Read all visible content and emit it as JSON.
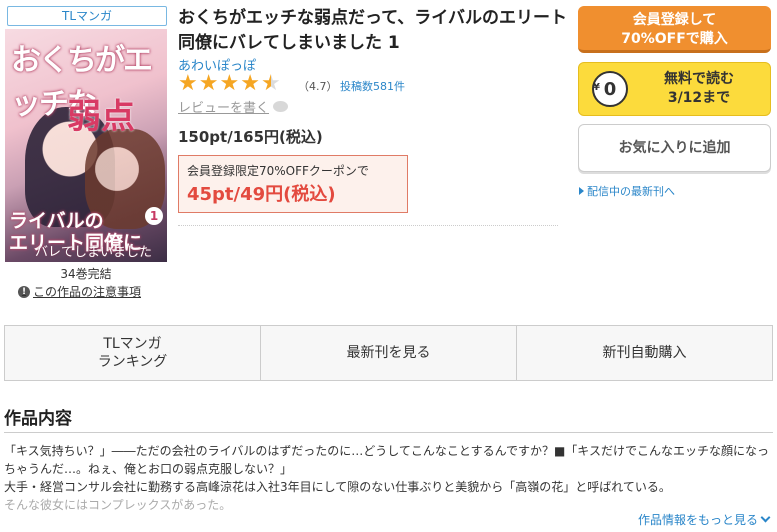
{
  "genre_tag": "TLマンガ",
  "cover": {
    "title_line1": "おくちが",
    "title_line2": "エッチな",
    "title_line3": "弱点",
    "bottom_line1": "ライバルの",
    "bottom_line2": "エリート同僚に",
    "bottom_line3": "バレてしまいました",
    "volume": "1"
  },
  "volume_count": "34巻完結",
  "notice_link": "この作品の注意事項",
  "title": "おくちがエッチな弱点だって、ライバルのエリート同僚にバレてしまいました 1",
  "author": "あわいぽっぽ",
  "rating": {
    "stars_filled": 4,
    "stars_half": 1,
    "stars_empty": 0,
    "value_text": "（4.7）",
    "value": 4.7
  },
  "post_count": "投稿数581件",
  "review_link": "レビューを書く",
  "price": "150pt/165円(税込)",
  "coupon": {
    "label": "会員登録限定70%OFFクーポンで",
    "price": "45pt/49円(税込)"
  },
  "buttons": {
    "register_line1": "会員登録して",
    "register_line2": "70%OFFで購入",
    "free_amount": "0",
    "free_yen": "¥",
    "free_line1": "無料で読む",
    "free_line2": "3/12まで",
    "favorite": "お気に入りに追加"
  },
  "latest_link": "配信中の最新刊へ",
  "action_bar": {
    "ranking_line1": "TLマンガ",
    "ranking_line2": "ランキング",
    "latest": "最新刊を見る",
    "auto_buy": "新刊自動購入"
  },
  "section_title": "作品内容",
  "description": {
    "line1": "「キス気持ちい？」――ただの会社のライバルのはずだったのに…どうしてこんなことするんですか？■「キスだけでこんなエッチな顔になっ",
    "line2": "ちゃうんだ…。ねぇ、俺とお口の弱点克服しない？」",
    "line3": "大手・経営コンサル会社に勤務する高峰涼花は入社3年目にして隙のない仕事ぶりと美貌から「高嶺の花」と呼ばれている。",
    "line4": "そんな彼女にはコンプレックスがあった。"
  },
  "more_link": "作品情報をもっと見る",
  "colors": {
    "accent_orange": "#f08f2f",
    "accent_yellow": "#fcdb3c",
    "link_blue": "#2a86c9",
    "coupon_red": "#e34a3f",
    "star": "#f5a623"
  },
  "icons": [
    "info-icon",
    "speech-bubble-icon",
    "star-icon",
    "yen-coin-icon",
    "triangle-right-icon",
    "chevron-down-icon"
  ]
}
